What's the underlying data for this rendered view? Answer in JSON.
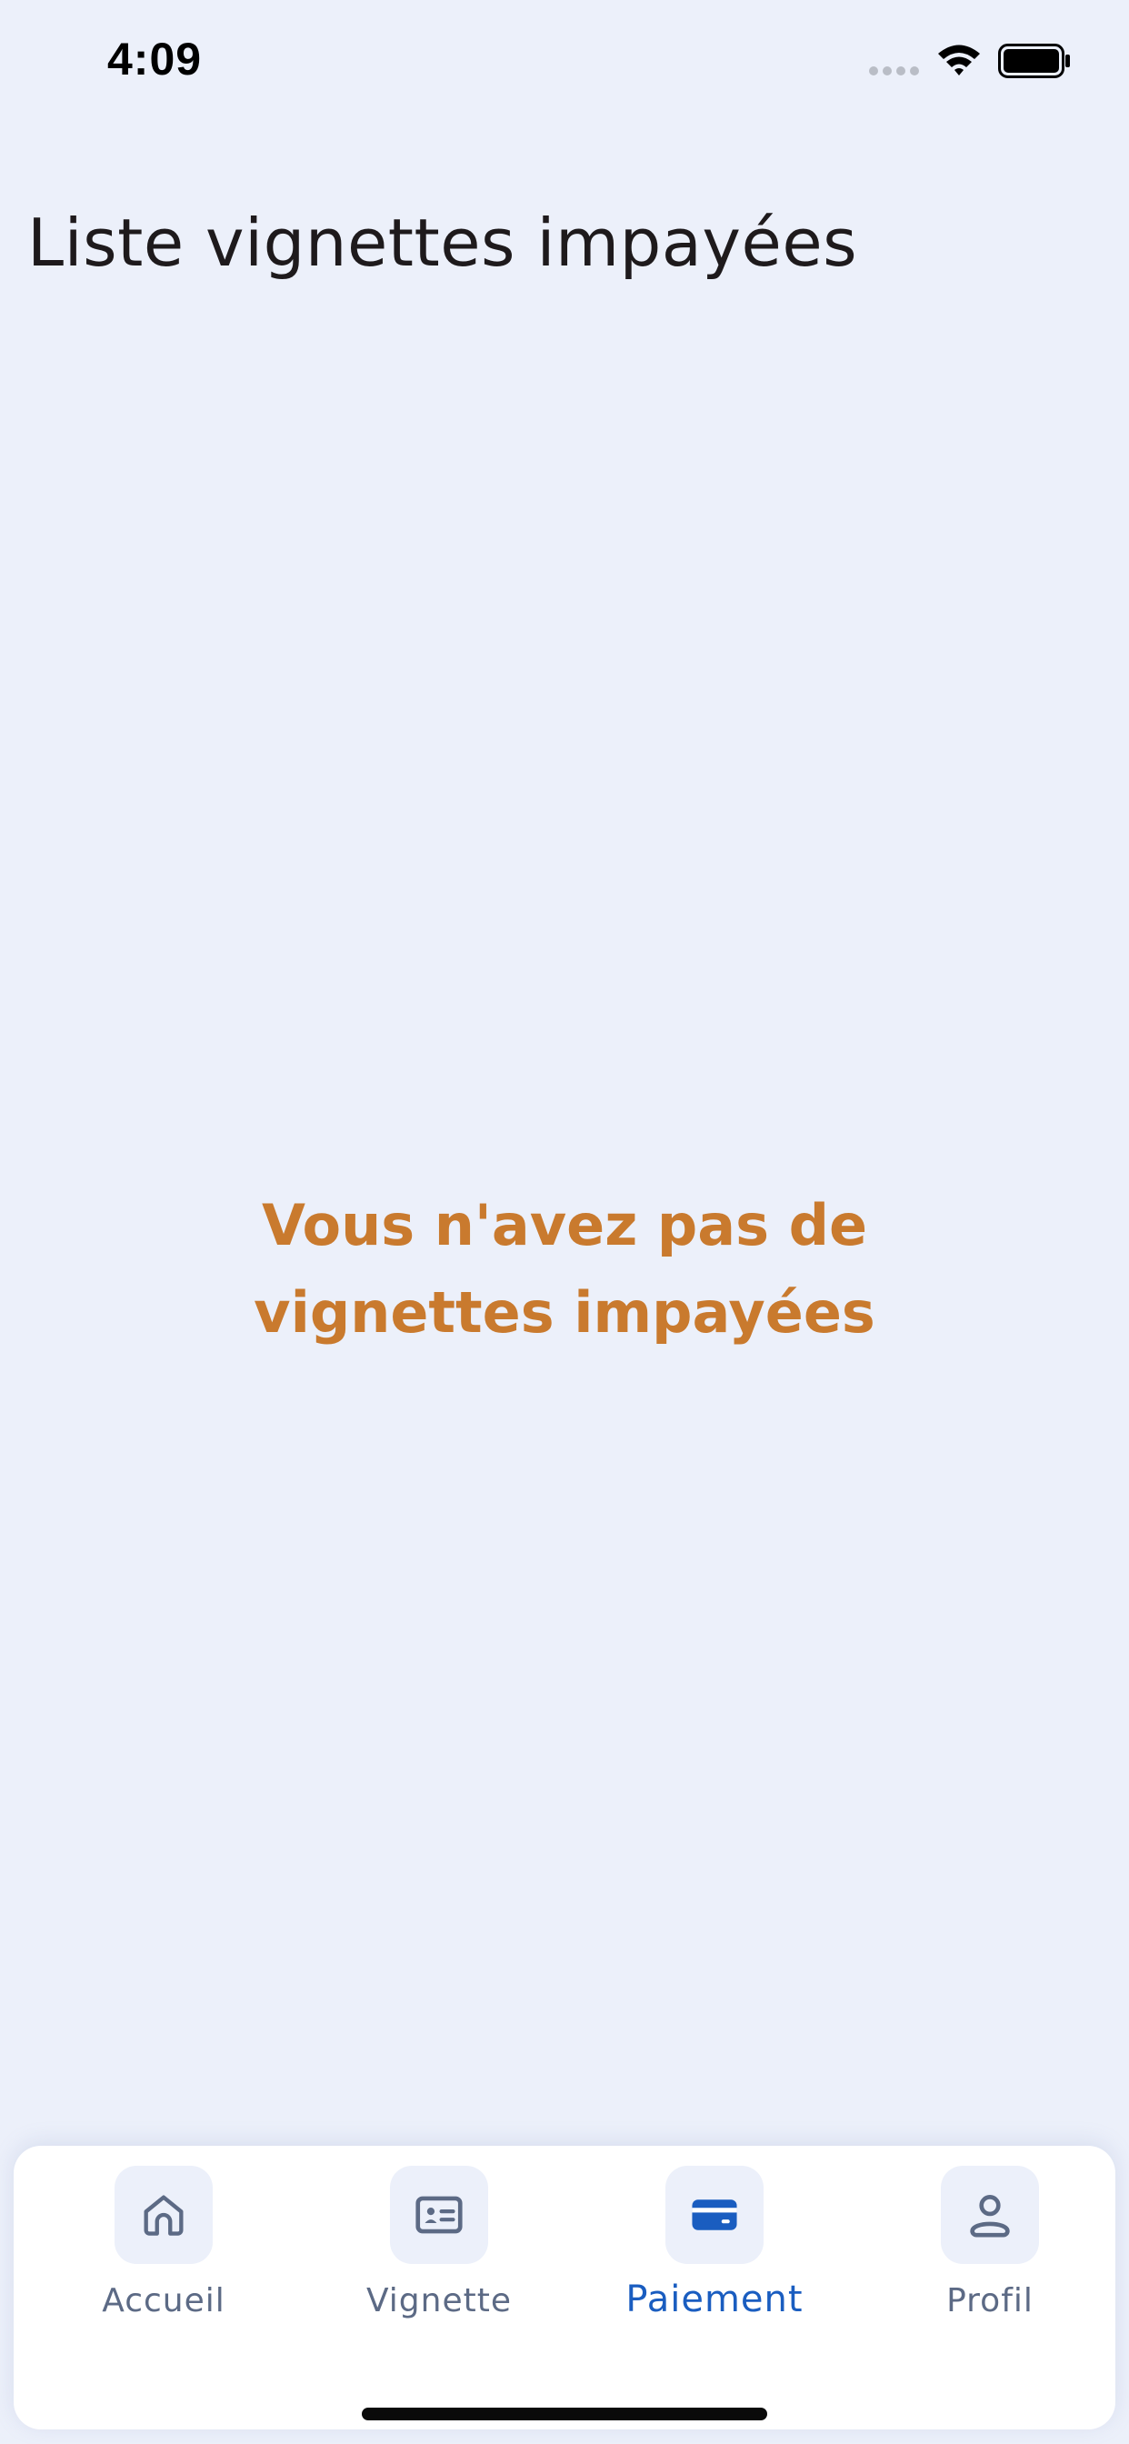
{
  "status_bar": {
    "time": "4:09"
  },
  "page": {
    "title": "Liste vignettes impayées"
  },
  "empty_state": {
    "message": "Vous n'avez pas de vignettes impayées"
  },
  "bottom_nav": {
    "items": [
      {
        "label": "Accueil",
        "icon": "home-icon",
        "active": false
      },
      {
        "label": "Vignette",
        "icon": "id-card-icon",
        "active": false
      },
      {
        "label": "Paiement",
        "icon": "credit-card-icon",
        "active": true
      },
      {
        "label": "Profil",
        "icon": "user-icon",
        "active": false
      }
    ]
  },
  "colors": {
    "background": "#ECF0FA",
    "accent_orange": "#C97A2E",
    "active_blue": "#1A5DC0",
    "inactive_gray": "#5C6A85"
  }
}
